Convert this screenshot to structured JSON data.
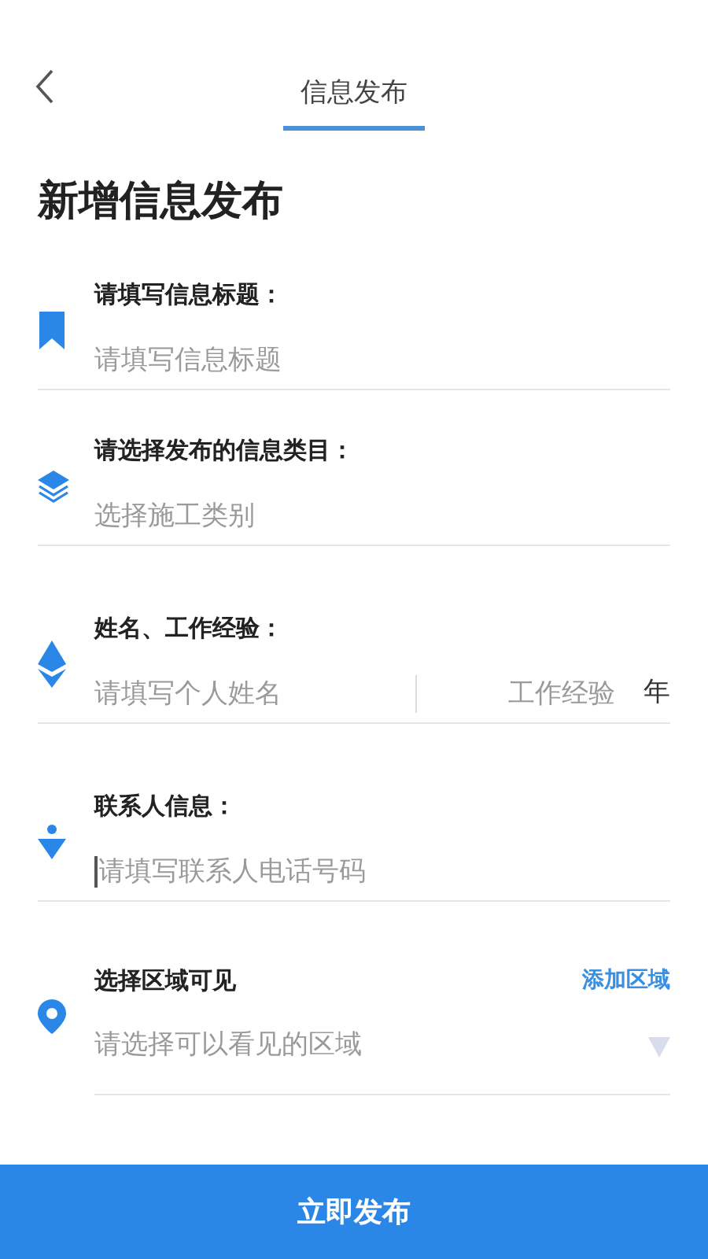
{
  "header": {
    "title": "信息发布"
  },
  "heading": "新增信息发布",
  "fields": [
    {
      "kind": "text",
      "label": "请填写信息标题：",
      "placeholder": "请填写信息标题"
    },
    {
      "kind": "text",
      "label": "请选择发布的信息类目：",
      "placeholder": "选择施工类别"
    },
    {
      "kind": "pair",
      "label": "姓名、工作经验：",
      "placeholder": "请填写个人姓名",
      "second_placeholder": "工作经验",
      "unit": "年"
    },
    {
      "kind": "text",
      "label": "联系人信息：",
      "placeholder": "请填写联系人电话号码",
      "focused": true
    },
    {
      "kind": "dropdown",
      "label": "选择区域可见",
      "action": "添加区域",
      "placeholder": "请选择可以看见的区域"
    }
  ],
  "submit": "立即发布"
}
